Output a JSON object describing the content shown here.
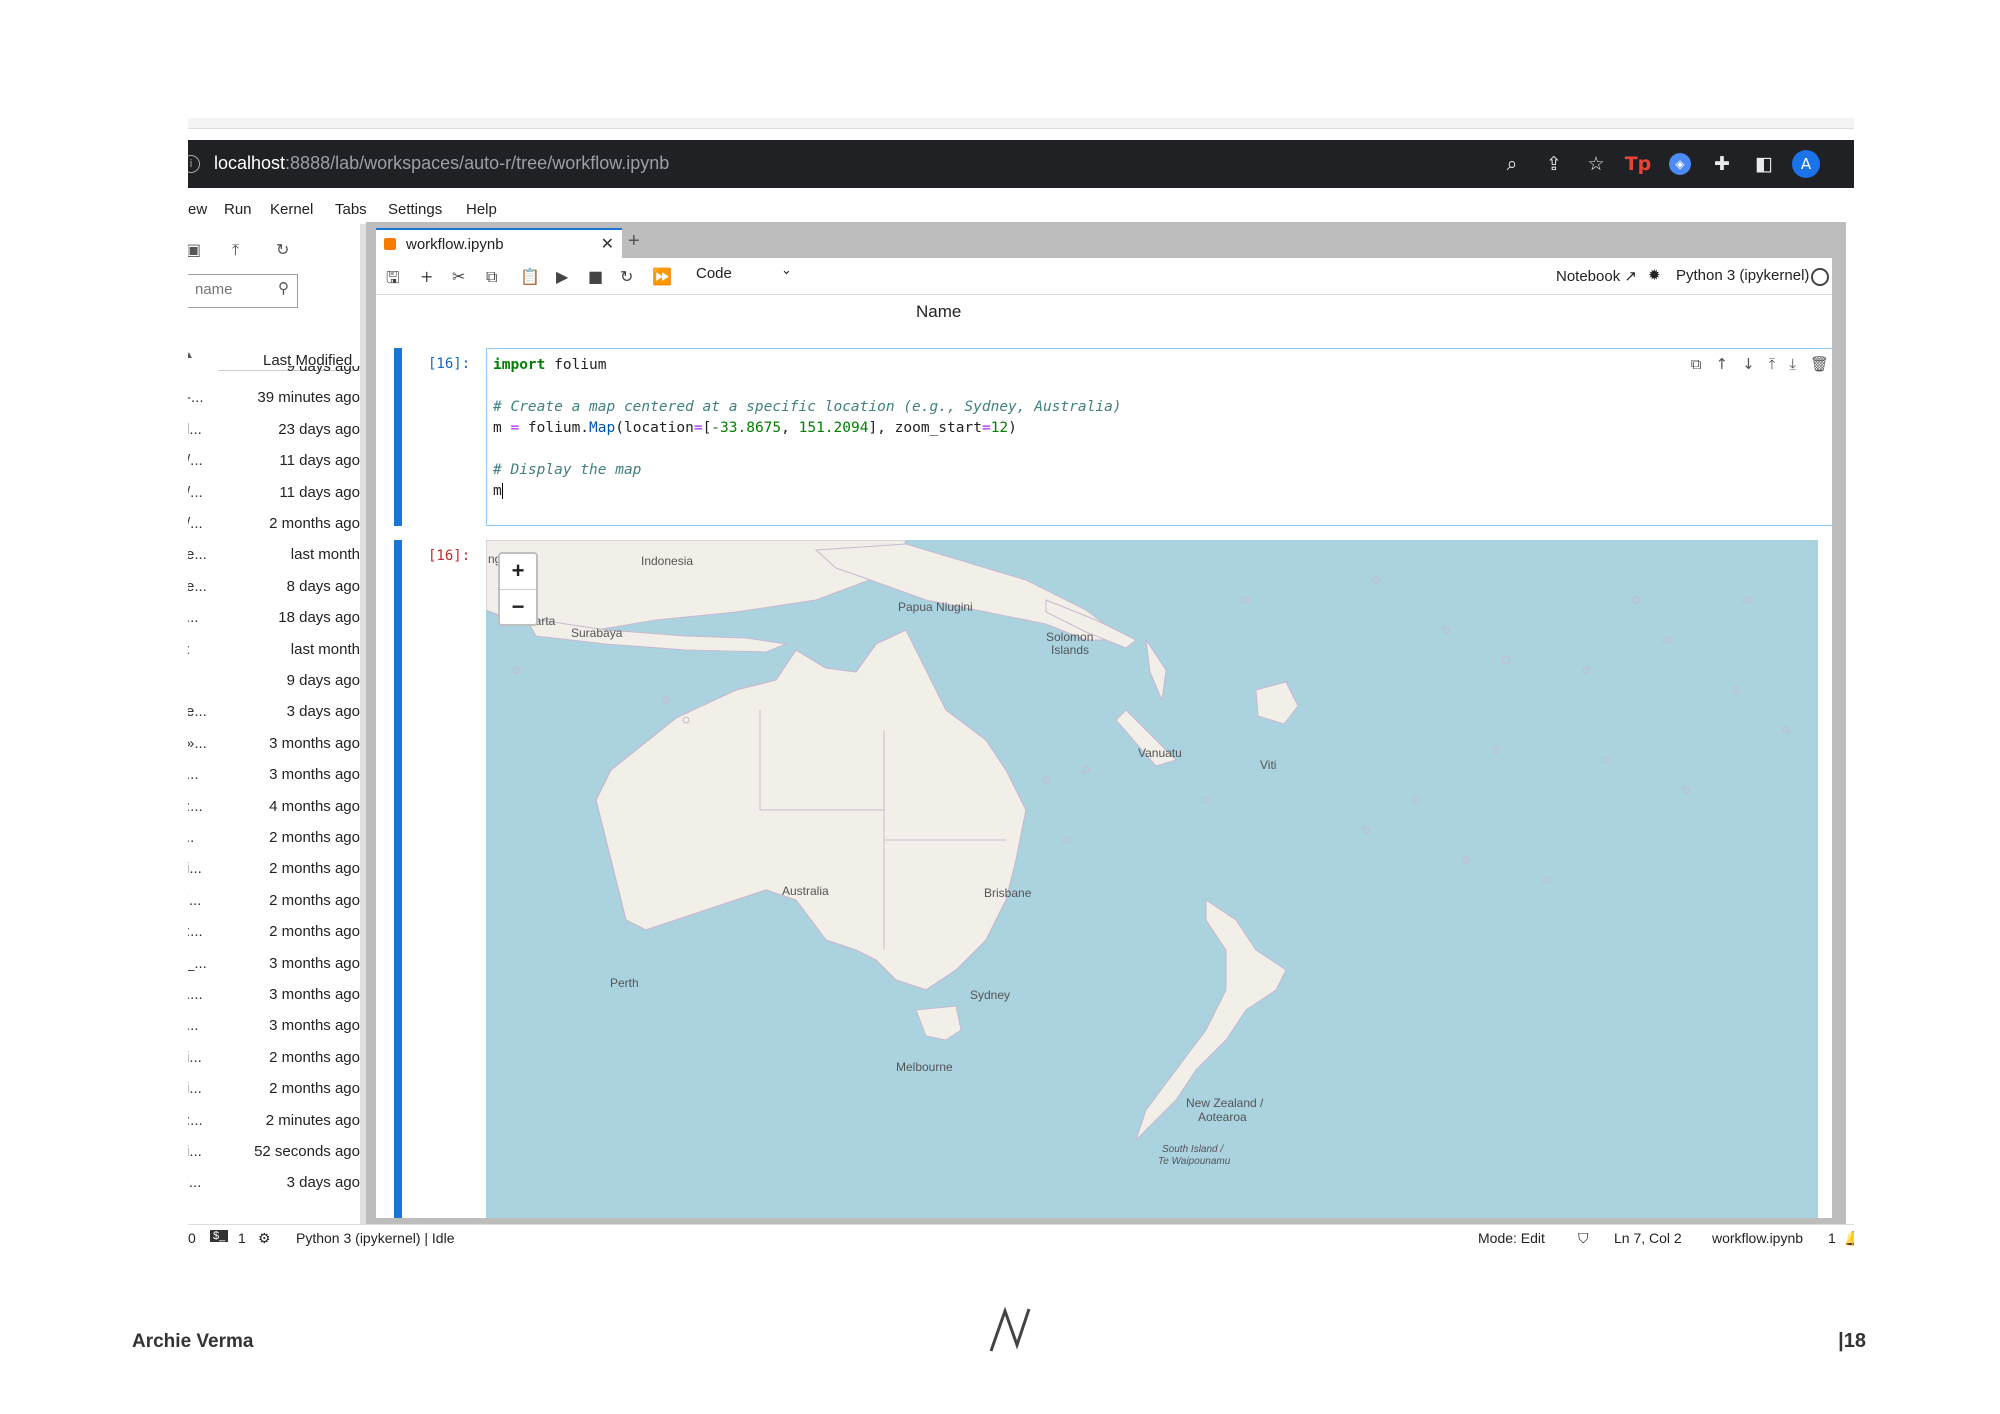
{
  "browser": {
    "url_host": "localhost",
    "url_rest": ":8888/lab/workspaces/auto-r/tree/workflow.ipynb",
    "avatar_letter": "A",
    "ext_tp": "Tp"
  },
  "menu": [
    "ew",
    "Run",
    "Kernel",
    "Tabs",
    "Settings",
    "Help"
  ],
  "filebrowser": {
    "filter_placeholder": "name",
    "column_header": "Last Modified",
    "rows": [
      {
        "name": "",
        "modified": "9 days ago"
      },
      {
        "name": "-...",
        "modified": "39 minutes ago"
      },
      {
        "name": "l...",
        "modified": "23 days ago"
      },
      {
        "name": "/...",
        "modified": "11 days ago"
      },
      {
        "name": "/...",
        "modified": "11 days ago"
      },
      {
        "name": "/...",
        "modified": "2 months ago"
      },
      {
        "name": "e...",
        "modified": "last month"
      },
      {
        "name": "e...",
        "modified": "8 days ago"
      },
      {
        "name": "...",
        "modified": "18 days ago"
      },
      {
        "name": ":",
        "modified": "last month"
      },
      {
        "name": "",
        "modified": "9 days ago"
      },
      {
        "name": "e...",
        "modified": "3 days ago"
      },
      {
        "name": "»...",
        "modified": "3 months ago"
      },
      {
        "name": "...",
        "modified": "3 months ago"
      },
      {
        "name": ":...",
        "modified": "4 months ago"
      },
      {
        "name": "..",
        "modified": "2 months ago"
      },
      {
        "name": "i...",
        "modified": "2 months ago"
      },
      {
        "name": "'...",
        "modified": "2 months ago"
      },
      {
        "name": ":...",
        "modified": "2 months ago"
      },
      {
        "name": "_...",
        "modified": "3 months ago"
      },
      {
        "name": "....",
        "modified": "3 months ago"
      },
      {
        "name": "...",
        "modified": "3 months ago"
      },
      {
        "name": "i...",
        "modified": "2 months ago"
      },
      {
        "name": "i...",
        "modified": "2 months ago"
      },
      {
        "name": ":...",
        "modified": "2 minutes ago"
      },
      {
        "name": "i...",
        "modified": "52 seconds ago"
      },
      {
        "name": "'...",
        "modified": "3 days ago"
      }
    ]
  },
  "notebook": {
    "tab_label": "workflow.ipynb",
    "cell_type": "Code",
    "notebook_link": "Notebook",
    "kernel_name": "Python 3 (ipykernel)",
    "prev_output_label": "Name",
    "input_prompt": "[16]:",
    "output_prompt": "[16]:",
    "code": {
      "l1_kw": "import",
      "l1_rest": " folium",
      "l3_comment": "# Create a map centered at a specific location (e.g., Sydney, Australia)",
      "l4_a": "m ",
      "l4_eq": "=",
      "l4_b": " folium.",
      "l4_fn": "Map",
      "l4_c": "(location",
      "l4_eq2": "=",
      "l4_d": "[",
      "l4_n1": "-33.8675",
      "l4_e": ", ",
      "l4_n2": "151.2094",
      "l4_f": "], zoom_start",
      "l4_eq3": "=",
      "l4_n3": "12",
      "l4_g": ")",
      "l6_comment": "# Display the map",
      "l7": "m"
    }
  },
  "map": {
    "zoom_in": "+",
    "zoom_out": "−",
    "labels": {
      "indonesia": "Indonesia",
      "jakarta": "Jakarta",
      "surabaya": "Surabaya",
      "papua": "Papua Niugini",
      "solomon1": "Solomon",
      "solomon2": "Islands",
      "vanuatu": "Vanuatu",
      "viti": "Viti",
      "australia": "Australia",
      "brisbane": "Brisbane",
      "perth": "Perth",
      "sydney": "Sydney",
      "melbourne": "Melbourne",
      "nz1": "New Zealand /",
      "nz2": "Aotearoa",
      "si1": "South Island /",
      "si2": "Te Waipounamu",
      "cut_left": "ng"
    },
    "land_color": "#f2efe9",
    "sea_color": "#aad3df"
  },
  "statusbar": {
    "left_count": "0",
    "terminals": "1",
    "kernel_status": "Python 3 (ipykernel) | Idle",
    "mode": "Mode: Edit",
    "position": "Ln 7, Col 2",
    "filename": "workflow.ipynb",
    "right_count": "1"
  },
  "footer": {
    "author": "Archie Verma",
    "page": "|18"
  }
}
